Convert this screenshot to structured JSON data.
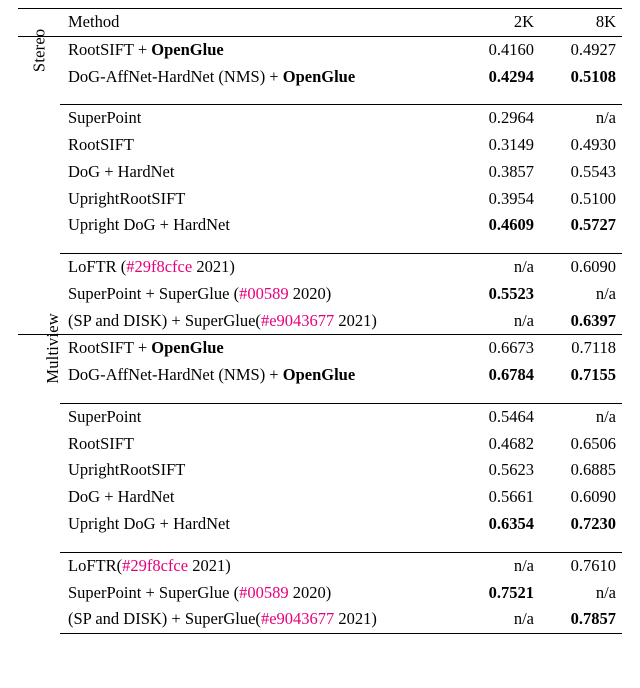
{
  "headers": {
    "method": "Method",
    "col2k": "2K",
    "col8k": "8K"
  },
  "categories": {
    "stereo": "Stereo",
    "multiview": "Multiview"
  },
  "colors": {
    "hash": "#e6007e"
  },
  "chart_data": {
    "type": "table",
    "sections": [
      {
        "category": "Stereo",
        "groups": [
          [
            {
              "method": "RootSIFT + __B__OpenGlue__/B__",
              "v2k": "0.4160",
              "v8k": "0.4927"
            },
            {
              "method": "DoG-AffNet-HardNet (NMS) + __B__OpenGlue__/B__",
              "v2k": "0.4294",
              "v8k": "0.5108",
              "bold2k": true,
              "bold8k": true
            }
          ],
          [
            {
              "method": "SuperPoint",
              "v2k": "0.2964",
              "v8k": "n/a"
            },
            {
              "method": "RootSIFT",
              "v2k": "0.3149",
              "v8k": "0.4930"
            },
            {
              "method": "DoG + HardNet",
              "v2k": "0.3857",
              "v8k": "0.5543"
            },
            {
              "method": "UprightRootSIFT",
              "v2k": "0.3954",
              "v8k": "0.5100"
            },
            {
              "method": "Upright DoG + HardNet",
              "v2k": "0.4609",
              "v8k": "0.5727",
              "bold2k": true,
              "bold8k": true
            }
          ],
          [
            {
              "method": "LoFTR (__H__#29f8cfce__/H__ 2021)",
              "v2k": "n/a",
              "v8k": "0.6090"
            },
            {
              "method": "SuperPoint + SuperGlue (__H__#00589__/H__ 2020)",
              "v2k": "0.5523",
              "v8k": "n/a",
              "bold2k": true
            },
            {
              "method": "(SP and DISK) + SuperGlue(__H__#e9043677__/H__ 2021)",
              "v2k": "n/a",
              "v8k": "0.6397",
              "bold8k": true
            }
          ]
        ]
      },
      {
        "category": "Multiview",
        "groups": [
          [
            {
              "method": "RootSIFT + __B__OpenGlue__/B__",
              "v2k": "0.6673",
              "v8k": "0.7118"
            },
            {
              "method": "DoG-AffNet-HardNet (NMS) + __B__OpenGlue__/B__",
              "v2k": "0.6784",
              "v8k": "0.7155",
              "bold2k": true,
              "bold8k": true
            }
          ],
          [
            {
              "method": "SuperPoint",
              "v2k": "0.5464",
              "v8k": "n/a"
            },
            {
              "method": "RootSIFT",
              "v2k": "0.4682",
              "v8k": "0.6506"
            },
            {
              "method": "UprightRootSIFT",
              "v2k": "0.5623",
              "v8k": "0.6885"
            },
            {
              "method": "DoG + HardNet",
              "v2k": "0.5661",
              "v8k": "0.6090"
            },
            {
              "method": "Upright DoG + HardNet",
              "v2k": "0.6354",
              "v8k": "0.7230",
              "bold2k": true,
              "bold8k": true
            }
          ],
          [
            {
              "method": "LoFTR(__H__#29f8cfce__/H__ 2021)",
              "v2k": "n/a",
              "v8k": "0.7610"
            },
            {
              "method": "SuperPoint + SuperGlue (__H__#00589__/H__ 2020)",
              "v2k": "0.7521",
              "v8k": "n/a",
              "bold2k": true
            },
            {
              "method": "(SP and DISK) + SuperGlue(__H__#e9043677__/H__ 2021)",
              "v2k": "n/a",
              "v8k": "0.7857",
              "bold8k": true
            }
          ]
        ]
      }
    ]
  }
}
